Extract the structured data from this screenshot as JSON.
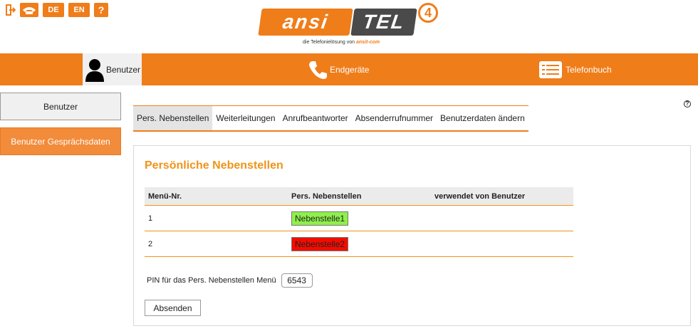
{
  "topbar": {
    "icons": [
      {
        "name": "exit-icon"
      },
      {
        "name": "phone-hangup-icon"
      },
      {
        "name": "lang-de",
        "label": "DE"
      },
      {
        "name": "lang-en",
        "label": "EN"
      },
      {
        "name": "help-icon",
        "label": "?"
      }
    ]
  },
  "logo": {
    "part1": "ansi",
    "part2": "TEL",
    "version": "4",
    "tagline": "die Telefonielösung von",
    "tagline_brand": "ansit-com"
  },
  "mainnav": {
    "items": [
      {
        "label": "Benutzer",
        "icon": "user-icon",
        "active": true
      },
      {
        "label": "Endgeräte",
        "icon": "phone-icon",
        "active": false
      },
      {
        "label": "Telefonbuch",
        "icon": "phonebook-icon",
        "active": false
      }
    ]
  },
  "sidebar": {
    "items": [
      {
        "label": "Benutzer"
      },
      {
        "label": "Benutzer Gesprächsdaten"
      }
    ]
  },
  "help_label": "?",
  "subtabs": [
    {
      "label": "Pers. Nebenstellen",
      "active": true
    },
    {
      "label": "Weiterleitungen"
    },
    {
      "label": "Anrufbeantworter"
    },
    {
      "label": "Absenderrufnummer"
    },
    {
      "label": "Benutzerdaten ändern"
    }
  ],
  "panel": {
    "title": "Persönliche Nebenstellen",
    "table": {
      "headers": [
        "Menü-Nr.",
        "Pers. Nebenstellen",
        "verwendet von Benutzer"
      ],
      "rows": [
        {
          "nr": "1",
          "ext": "Nebenstelle1",
          "used_by": ""
        },
        {
          "nr": "2",
          "ext": "Nebenstelle2",
          "used_by": ""
        }
      ]
    },
    "pin_label": "PIN für das Pers. Nebenstellen Menü",
    "pin_value": "6543",
    "submit_label": "Absenden"
  },
  "colors": {
    "accent": "#ef7d1a",
    "title": "#ef9419",
    "ext_green": "#8ef04b",
    "ext_red": "#f20c00"
  }
}
